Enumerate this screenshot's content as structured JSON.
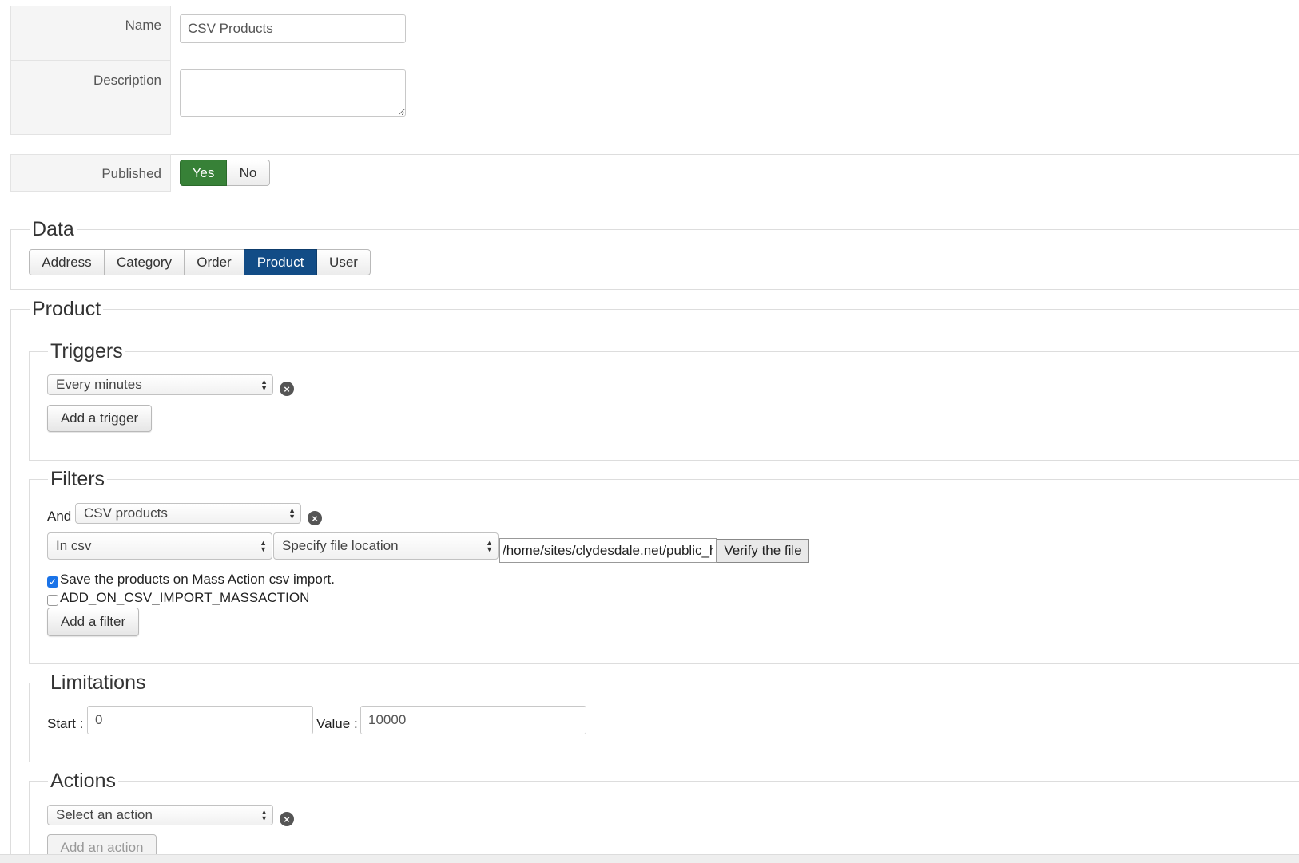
{
  "form": {
    "name_label": "Name",
    "name_value": "CSV Products",
    "description_label": "Description",
    "description_value": "",
    "published_label": "Published",
    "published_yes": "Yes",
    "published_no": "No"
  },
  "data_section": {
    "legend": "Data",
    "tabs": [
      {
        "label": "Address",
        "active": false
      },
      {
        "label": "Category",
        "active": false
      },
      {
        "label": "Order",
        "active": false
      },
      {
        "label": "Product",
        "active": true
      },
      {
        "label": "User",
        "active": false
      }
    ]
  },
  "product": {
    "legend": "Product",
    "triggers": {
      "legend": "Triggers",
      "select_value": "Every minutes",
      "add_button": "Add a trigger"
    },
    "filters": {
      "legend": "Filters",
      "and_label": "And",
      "filter_select": "CSV products",
      "source_select": "In csv",
      "location_select": "Specify file location",
      "path_value": "/home/sites/clydesdale.net/public_h",
      "verify_button": "Verify the file",
      "save_checkbox_label": "Save the products on Mass Action csv import.",
      "save_checkbox_checked": true,
      "add_checkbox_label": "ADD_ON_CSV_IMPORT_MASSACTION",
      "add_checkbox_checked": false,
      "add_button": "Add a filter"
    },
    "limitations": {
      "legend": "Limitations",
      "start_label": "Start :",
      "start_value": "0",
      "value_label": "Value :",
      "value_value": "10000"
    },
    "actions": {
      "legend": "Actions",
      "select_value": "Select an action",
      "add_button": "Add an action"
    }
  },
  "colors": {
    "published_active": "#378137",
    "tab_active": "#124c86"
  }
}
